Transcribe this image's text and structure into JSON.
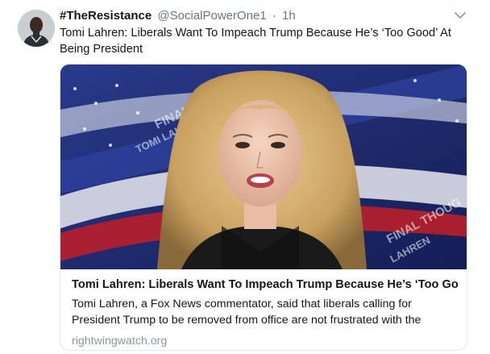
{
  "tweet": {
    "fullname": "#TheResistance",
    "username": "@SocialPowerOne1",
    "separator": "·",
    "time": "1h",
    "text": "Tomi Lahren: Liberals Want To Impeach Trump Because He’s ‘Too Good’ At Being President"
  },
  "card": {
    "title": "Tomi Lahren: Liberals Want To Impeach Trump Because He’s ‘Too Go...",
    "description": "Tomi Lahren, a Fox News commentator, said that liberals calling for President Trump to be removed from office are not frustrated with the",
    "domain": "rightwingwatch.org",
    "image_caption_fragments": [
      "FINAL THOUG",
      "LAHREN",
      "TOMI LAHREN",
      "FINAL TH",
      "LAHREN"
    ]
  },
  "icons": {
    "caret": "chevron-down-icon"
  },
  "colors": {
    "secondary_text": "#657786",
    "domain_text": "#8899a6",
    "card_border": "#e1e8ed",
    "flag_blue": "#1c2a6b"
  }
}
